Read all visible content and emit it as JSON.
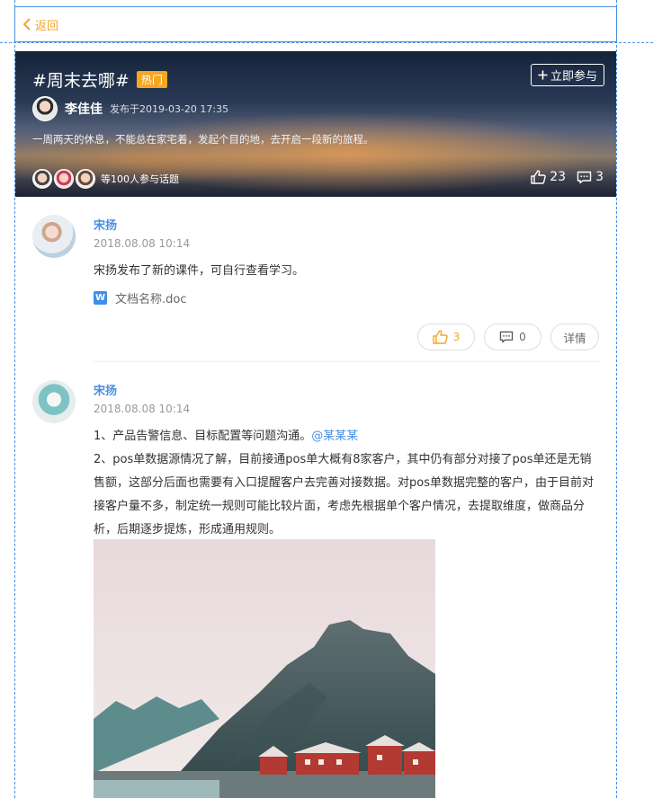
{
  "header": {
    "back_label": "返回"
  },
  "topic": {
    "title": "#周末去哪#",
    "hot_badge": "热门",
    "join_label": "立即参与",
    "author_name": "李佳佳",
    "publish_time": "发布于2019-03-20 17:35",
    "description": "一周两天的休息，不能总在家宅着，发起个目的地，去开启一段新的旅程。",
    "participants_text": "等100人参与话题",
    "likes": "23",
    "comments": "3"
  },
  "posts": [
    {
      "author": "宋扬",
      "time": "2018.08.08 10:14",
      "content": "宋扬发布了新的课件，可自行查看学习。",
      "attachment": "文档名称.doc",
      "like_count": "3",
      "comment_count": "0",
      "detail_label": "详情"
    },
    {
      "author": "宋扬",
      "time": "2018.08.08 10:14",
      "line1": "1、产品告警信息、目标配置等问题沟通。",
      "mention": "@某某某",
      "paragraph": "2、pos单数据源情况了解，目前接通pos单大概有8家客户，其中仍有部分对接了pos单还是无销售额，这部分后面也需要有入口提醒客户去完善对接数据。对pos单数据完整的客户，由于目前对接客户量不多，制定统一规则可能比较片面，考虑先根据单个客户情况，去提取维度，做商品分析，后期逐步提炼，形成通用规则。"
    }
  ],
  "colors": {
    "accent": "#f5a623",
    "link": "#4a90e2",
    "guide": "#4a90e2"
  }
}
